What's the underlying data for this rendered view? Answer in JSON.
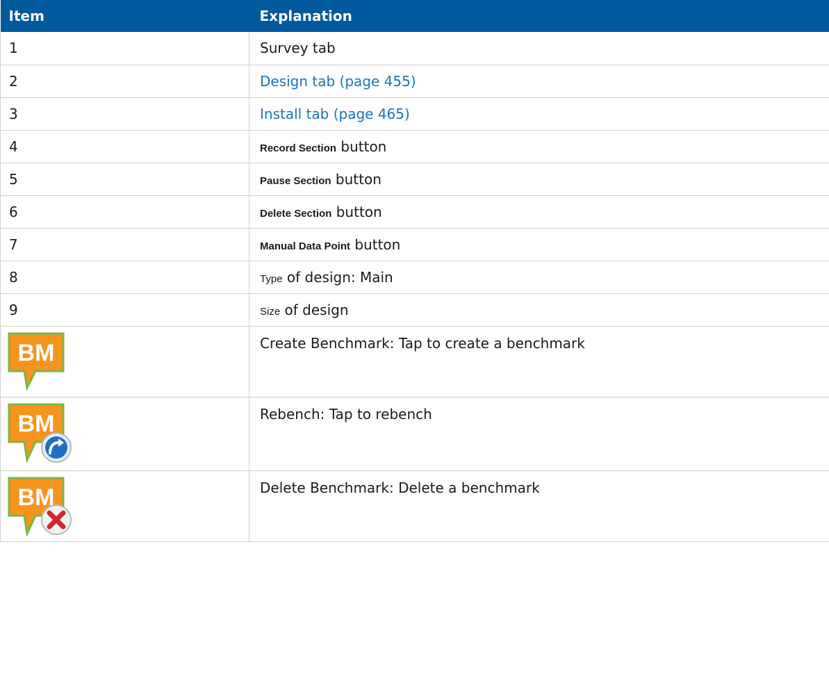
{
  "table": {
    "headers": {
      "item": "Item",
      "explanation": "Explanation"
    },
    "rows": [
      {
        "item": "1",
        "explanation": "Survey tab"
      },
      {
        "item": "2",
        "explanation": "Design tab (page 455)"
      },
      {
        "item": "3",
        "explanation": "Install tab (page 465)"
      },
      {
        "item": "4",
        "label_bold": "Record Section",
        "suffix": " button"
      },
      {
        "item": "5",
        "label_bold": "Pause Section",
        "suffix": " button"
      },
      {
        "item": "6",
        "label_bold": "Delete Section",
        "suffix": " button"
      },
      {
        "item": "7",
        "label_bold": "Manual Data Point",
        "suffix": " button"
      },
      {
        "item": "8",
        "prefix_small": "Type",
        "rest": " of design: Main"
      },
      {
        "item": "9",
        "prefix_small": "Size",
        "rest": " of design"
      }
    ],
    "icon_rows": [
      {
        "icon": "benchmark-create-icon",
        "badge_text": "BM",
        "explanation": "Create Benchmark: Tap to create a benchmark"
      },
      {
        "icon": "benchmark-rebench-icon",
        "badge_text": "BM",
        "explanation": "Rebench: Tap to rebench"
      },
      {
        "icon": "benchmark-delete-icon",
        "badge_text": "BM",
        "explanation": "Delete Benchmark: Delete a benchmark"
      }
    ]
  },
  "colors": {
    "header_bg": "#00599c",
    "link": "#1a73c0",
    "bm_orange": "#f7941d",
    "bm_border": "#7ab648"
  }
}
